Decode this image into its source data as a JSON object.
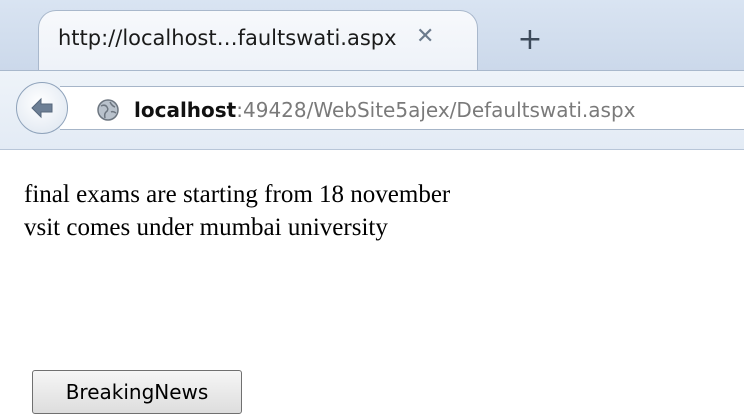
{
  "browser": {
    "tab_title": "http://localhost…faultswati.aspx",
    "tab_close": "✕",
    "new_tab": "+",
    "url_host": "localhost",
    "url_rest": ":49428/WebSite5ajex/Defaultswati.aspx"
  },
  "page": {
    "lines": [
      "final exams are starting from 18 november",
      "vsit comes under mumbai university"
    ],
    "button_label": "BreakingNews"
  },
  "icons": {
    "back": "back-arrow-icon",
    "globe": "globe-icon"
  }
}
